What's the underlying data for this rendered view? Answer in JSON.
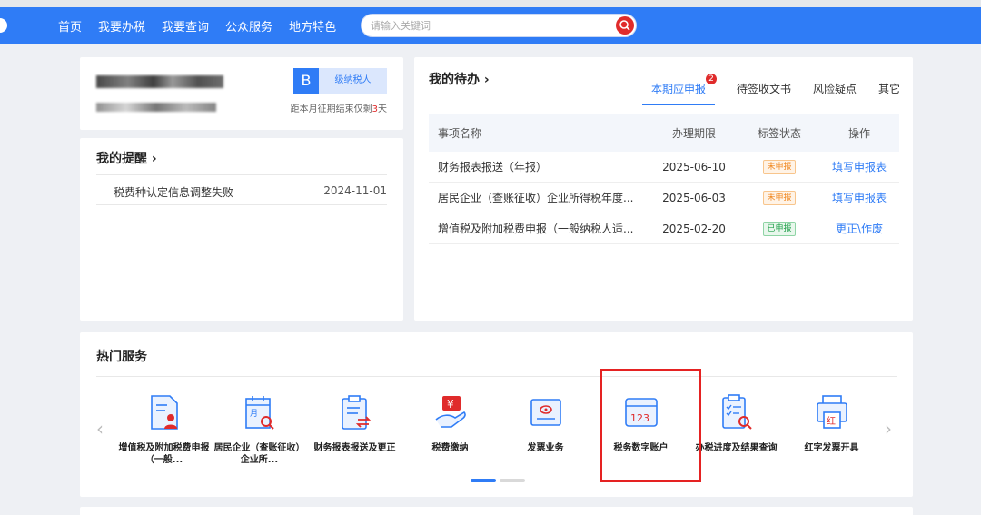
{
  "nav": {
    "items": [
      "首页",
      "我要办税",
      "我要查询",
      "公众服务",
      "地方特色"
    ],
    "search_placeholder": "请输入关键词"
  },
  "company": {
    "taxpayer_grade": "B",
    "taxpayer_grade_label": "级纳税人",
    "deadline_prefix": "距本月征期结束仅剩",
    "deadline_days": "3",
    "deadline_suffix": "天"
  },
  "reminders": {
    "title": "我的提醒 ›",
    "items": [
      {
        "text": "税费种认定信息调整失败",
        "date": "2024-11-01"
      }
    ]
  },
  "todo": {
    "title": "我的待办 ›",
    "tabs": [
      {
        "label": "本期应申报",
        "badge": "2"
      },
      {
        "label": "待签收文书"
      },
      {
        "label": "风险疑点"
      },
      {
        "label": "其它"
      }
    ],
    "columns": [
      "事项名称",
      "办理期限",
      "标签状态",
      "操作"
    ],
    "rows": [
      {
        "name": "财务报表报送（年报）",
        "deadline": "2025-06-10",
        "status": "未申报",
        "status_type": "pending",
        "action": "填写申报表"
      },
      {
        "name": "居民企业（查账征收）企业所得税年度...",
        "deadline": "2025-06-03",
        "status": "未申报",
        "status_type": "pending",
        "action": "填写申报表"
      },
      {
        "name": "增值税及附加税费申报（一般纳税人适...",
        "deadline": "2025-02-20",
        "status": "已申报",
        "status_type": "done",
        "action": "更正\\作废"
      }
    ]
  },
  "hot_services": {
    "title": "热门服务",
    "items": [
      {
        "label": "增值税及附加税费申报（一般...",
        "icon": "document-user-icon"
      },
      {
        "label": "居民企业（查账征收）企业所...",
        "icon": "calendar-search-icon"
      },
      {
        "label": "财务报表报送及更正",
        "icon": "clipboard-transfer-icon"
      },
      {
        "label": "税费缴纳",
        "icon": "yuan-hand-icon"
      },
      {
        "label": "发票业务",
        "icon": "invoice-icon"
      },
      {
        "label": "税务数字账户",
        "icon": "digital-account-icon"
      },
      {
        "label": "办税进度及结果查询",
        "icon": "checklist-search-icon"
      },
      {
        "label": "红字发票开具",
        "icon": "red-invoice-printer-icon"
      }
    ],
    "highlighted_index": 5,
    "page_count": 2,
    "active_page": 1
  },
  "colors": {
    "primary": "#2f7cf6",
    "danger": "#e02b2b",
    "highlight_border": "#e52222"
  }
}
